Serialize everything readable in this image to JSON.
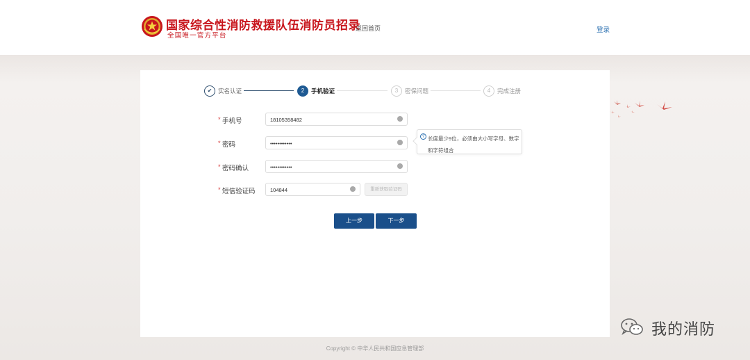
{
  "header": {
    "title": "国家综合性消防救援队伍消防员招录",
    "subtitle": "全国唯一官方平台",
    "home_link": "返回首页",
    "login_link": "登录"
  },
  "steps": [
    {
      "label": "实名认证",
      "marker": "✔",
      "state": "done"
    },
    {
      "label": "手机验证",
      "marker": "2",
      "state": "active"
    },
    {
      "label": "密保问题",
      "marker": "3",
      "state": "todo"
    },
    {
      "label": "完成注册",
      "marker": "4",
      "state": "todo"
    }
  ],
  "form": {
    "phone": {
      "label": "手机号",
      "value": "18105358482"
    },
    "password": {
      "label": "密码",
      "value": "••••••••••••"
    },
    "password_confirm": {
      "label": "密码确认",
      "value": "••••••••••••"
    },
    "sms_code": {
      "label": "短信验证码",
      "value": "104844",
      "button": "重新获取验证码"
    },
    "required_mark": "*"
  },
  "password_hint": {
    "icon": "?",
    "text": "长度最少9位，必须由大小写字母、数字和字符组合"
  },
  "buttons": {
    "prev": "上一步",
    "next": "下一步"
  },
  "footer": {
    "copyright": "Copyright © 中华人民共和国应急管理部"
  },
  "watermark": {
    "text": "我的消防"
  },
  "colors": {
    "brand_red": "#c8161d",
    "primary_blue": "#1a4f8a",
    "link_blue": "#2a6fb0"
  }
}
